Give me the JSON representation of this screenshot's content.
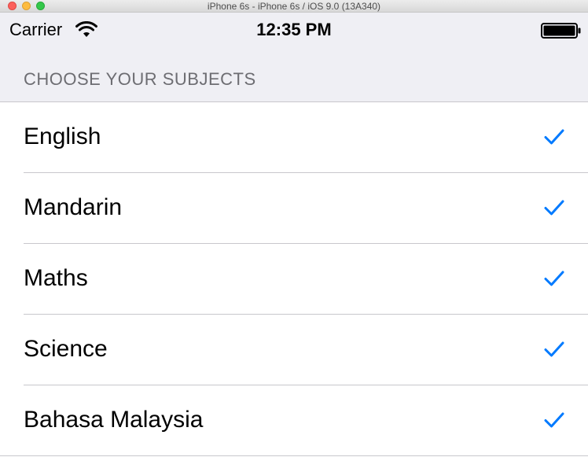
{
  "window": {
    "title": "iPhone 6s - iPhone 6s / iOS 9.0 (13A340)"
  },
  "status_bar": {
    "carrier": "Carrier",
    "time": "12:35 PM",
    "wifi_icon": "wifi-icon",
    "battery_icon": "battery-icon"
  },
  "section": {
    "header": "CHOOSE YOUR SUBJECTS"
  },
  "subjects": [
    {
      "label": "English",
      "checked": true
    },
    {
      "label": "Mandarin",
      "checked": true
    },
    {
      "label": "Maths",
      "checked": true
    },
    {
      "label": "Science",
      "checked": true
    },
    {
      "label": "Bahasa Malaysia",
      "checked": true
    }
  ],
  "colors": {
    "accent": "#007aff",
    "background": "#efeff4",
    "separator": "#c8c7cc",
    "header_text": "#6d6d72"
  }
}
